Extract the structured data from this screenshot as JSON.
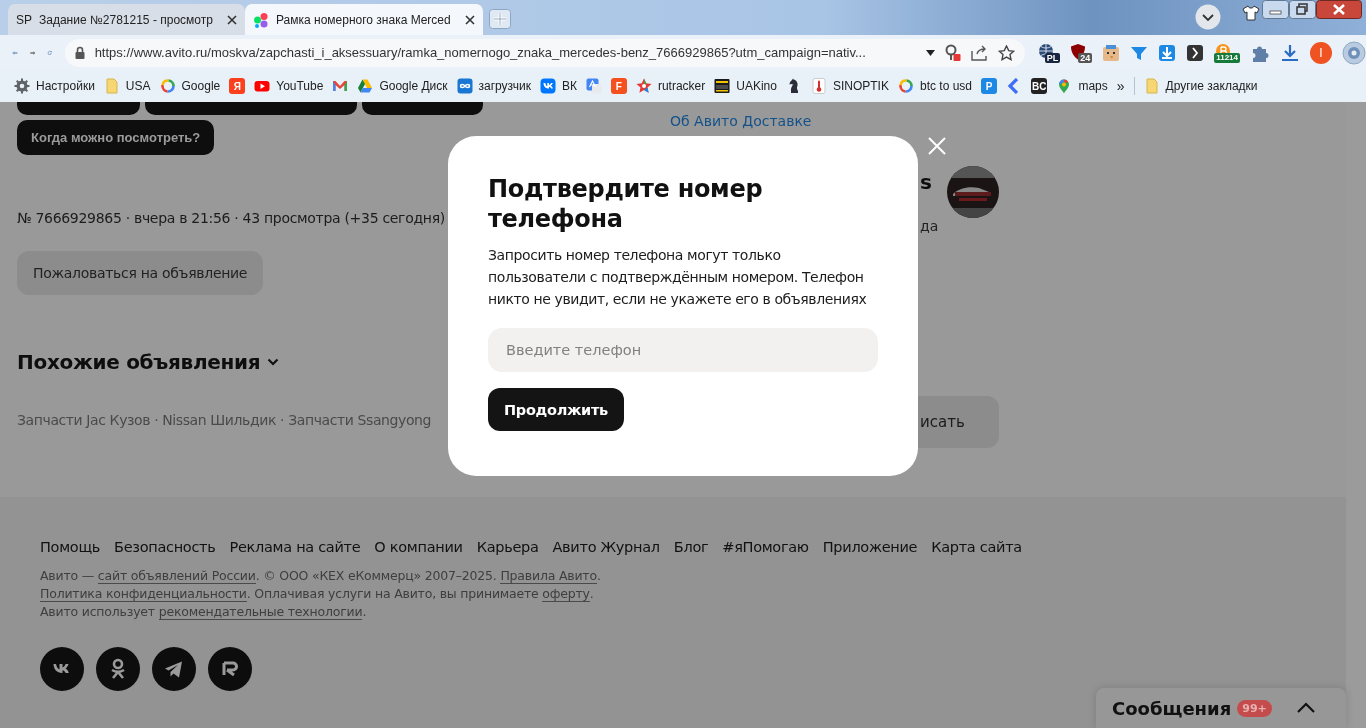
{
  "browser": {
    "tabs": [
      {
        "title": "Задание №2781215 - просмотр",
        "selected": false,
        "kind": "sp",
        "glyph": "SP"
      },
      {
        "title": "Рамка номерного знака Merced",
        "selected": true,
        "kind": "dots"
      }
    ],
    "url": "https://www.avito.ru/moskva/zapchasti_i_aksessuary/ramka_nomernogo_znaka_mercedes-benz_7666929865?utm_campaign=nativ...",
    "extension_badges": [
      "PL",
      "24",
      "11214"
    ],
    "profile_initial": "I",
    "bookmarks": [
      {
        "label": "Настройки",
        "kind": "gear"
      },
      {
        "label": "USA",
        "kind": "folder"
      },
      {
        "label": "Google",
        "kind": "ring"
      },
      {
        "kind": "letter",
        "glyph": "Я",
        "color": "#fc3f1d"
      },
      {
        "label": "YouTube",
        "kind": "play"
      },
      {
        "kind": "envelope"
      },
      {
        "label": "Google Диск",
        "kind": "triangle"
      },
      {
        "label": "загрузчик",
        "kind": "infinity"
      },
      {
        "label": "ВК",
        "kind": "square"
      },
      {
        "kind": "translate"
      },
      {
        "kind": "letter",
        "glyph": "F",
        "color": "#f4511e"
      },
      {
        "label": "rutracker",
        "kind": "star"
      },
      {
        "label": "UAKino",
        "kind": "film"
      },
      {
        "kind": "knight"
      },
      {
        "label": "SINOPTIK",
        "kind": "thermometer"
      },
      {
        "label": "btc to usd",
        "kind": "ring"
      },
      {
        "kind": "letter",
        "glyph": "P",
        "color": "#1e88e5"
      },
      {
        "kind": "chevron"
      },
      {
        "kind": "letter",
        "glyph": "BC",
        "color": "#222222"
      },
      {
        "label": "maps",
        "kind": "pin"
      }
    ],
    "more": "»",
    "other_bookmarks": "Другие закладки"
  },
  "page": {
    "question_chip": "Когда можно посмотреть?",
    "ad_info": "№ 7666929865 · вчера в 21:56 · 43 просмотра (+35 сегодня)",
    "report_button": "Пожаловаться на объявление",
    "similar_heading": "Похожие объявления",
    "similar_links": "Запчасти Jac Кузов · Nissan Шильдик · Запчасти Ssangyong",
    "delivery_link": "Об Авито Доставке",
    "seller_name_fragment": "s",
    "seller_note_fragment": "да",
    "write_button_fragment": "исать"
  },
  "modal": {
    "title": "Подтвердите номер телефона",
    "text": "Запросить номер телефона могут только пользователи с подтверждённым номером. Телефон никто не увидит, если не укажете его в объявлениях",
    "phone": {
      "placeholder": "Введите телефон"
    },
    "button": "Продолжить"
  },
  "footer": {
    "links": [
      "Помощь",
      "Безопасность",
      "Реклама на сайте",
      "О компании",
      "Карьера",
      "Авито Журнал",
      "Блог",
      "#яПомогаю",
      "Приложение",
      "Карта сайта"
    ],
    "legal": [
      [
        {
          "text": "Авито — ",
          "link": false
        },
        {
          "text": "сайт объявлений России",
          "link": true
        },
        {
          "text": ". © ООО «КЕХ еКоммерц» 2007–2025. ",
          "link": false
        },
        {
          "text": "Правила Авито",
          "link": true
        },
        {
          "text": ".",
          "link": false
        }
      ],
      [
        {
          "text": "Политика конфиденциальности",
          "link": true
        },
        {
          "text": ". Оплачивая услуги на Авито, вы принимаете ",
          "link": false
        },
        {
          "text": "оферту",
          "link": true
        },
        {
          "text": ".",
          "link": false
        }
      ],
      [
        {
          "text": "Авито использует ",
          "link": false
        },
        {
          "text": "рекомендательные технологии",
          "link": true
        },
        {
          "text": ".",
          "link": false
        }
      ]
    ],
    "socials": [
      {
        "kind": "vk"
      },
      {
        "kind": "ok"
      },
      {
        "kind": "telegram"
      },
      {
        "kind": "r"
      }
    ]
  },
  "messages": {
    "label": "Сообщения",
    "badge": "99+"
  }
}
